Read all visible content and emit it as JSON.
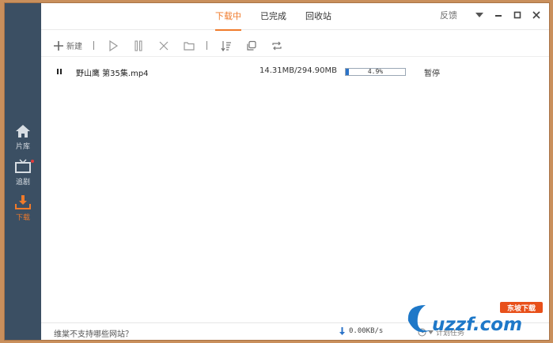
{
  "sidebar": {
    "items": [
      {
        "label": "片库",
        "icon": "home-icon"
      },
      {
        "label": "追剧",
        "icon": "tv-icon"
      },
      {
        "label": "下载",
        "icon": "download-icon"
      }
    ]
  },
  "header": {
    "tabs": [
      {
        "label": "下载中",
        "active": true
      },
      {
        "label": "已完成",
        "active": false
      },
      {
        "label": "回收站",
        "active": false
      }
    ],
    "feedback_label": "反馈"
  },
  "toolbar": {
    "new_label": "新建"
  },
  "downloads": [
    {
      "name": "野山鹰 第35集.mp4",
      "size": "14.31MB/294.90MB",
      "progress_text": "4.9%",
      "progress": 0.049,
      "status": "暂停"
    }
  ],
  "statusbar": {
    "unsupported_link": "维棠不支持哪些网站？",
    "speed": "0.00KB/s",
    "plan_label": "计划任务"
  },
  "watermark": {
    "text": "uzzf.com",
    "badge": "东坡下载"
  },
  "colors": {
    "accent": "#f07a2a",
    "sidebar_bg": "#3b4f63",
    "progress_fill": "#2b73c8"
  }
}
